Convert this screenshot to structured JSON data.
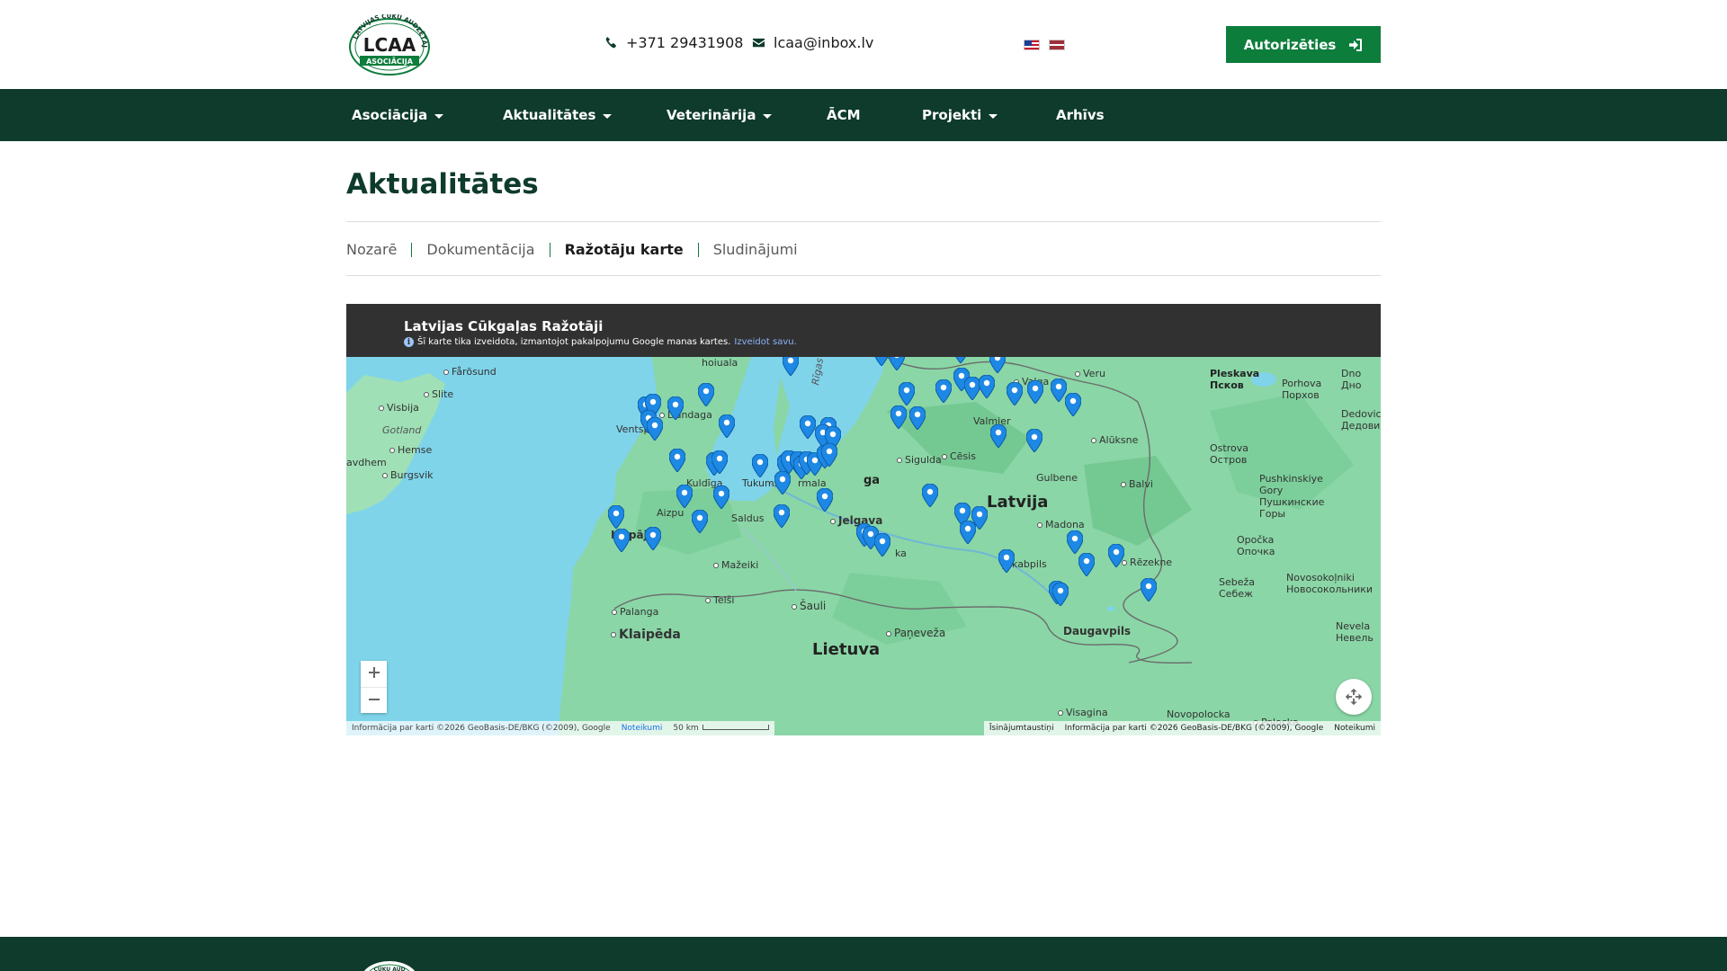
{
  "header": {
    "logo": {
      "arc_text": "LATVIJAS CŪKU AUDZĒTĀJU",
      "main_text": "LCAA",
      "ribbon_text": "ASOCIĀCIJA"
    },
    "phone": "+371 29431908",
    "email": "lcaa@inbox.lv",
    "languages": [
      "en",
      "lv"
    ],
    "login_label": "Autorizēties",
    "colors": {
      "primary_green": "#0d7d3c",
      "dark_green": "#0e3b2b"
    }
  },
  "nav": {
    "items": [
      {
        "label": "Asociācija",
        "has_dropdown": true
      },
      {
        "label": "Aktualitātes",
        "has_dropdown": true
      },
      {
        "label": "Veterinārija",
        "has_dropdown": true
      },
      {
        "label": "ĀCM",
        "has_dropdown": false
      },
      {
        "label": "Projekti",
        "has_dropdown": true
      },
      {
        "label": "Arhīvs",
        "has_dropdown": false
      }
    ]
  },
  "page": {
    "title": "Aktualitātes",
    "tabs": [
      {
        "label": "Nozarē",
        "active": false
      },
      {
        "label": "Dokumentācija",
        "active": false
      },
      {
        "label": "Ražotāju karte",
        "active": true
      },
      {
        "label": "Sludinājumi",
        "active": false
      }
    ]
  },
  "map": {
    "title": "Latvijas Cūkgaļas Ražotāji",
    "info_text": "Šī karte tika izveidota, izmantojot pakalpojumu Google manas kartes.",
    "info_link": "Izveidot savu.",
    "labels": {
      "country_latvia": "Latvija",
      "country_lithuania": "Lietuva",
      "gotland": "Gotland",
      "gulf": "Rīgas līcis",
      "hoiuala": "hoiuala",
      "farosund": "Fårösund",
      "slite": "Slite",
      "visbija": "Visbija",
      "hemse": "Hemse",
      "burgsvik": "Burgsvik",
      "ljavdhem": "avdhem",
      "ventspils": "Ventspils",
      "dundaga": "Dundaga",
      "kuldiga": "Kuldīga",
      "tukums": "Tukums",
      "jurmala": "rmala",
      "riga": "ga",
      "aizpute": "Aizpu",
      "saldus": "Saldus",
      "liepaja": "Liepāja",
      "jelgava": "Jelgava",
      "bauska": "ka",
      "mazeiki": "Mažeiki",
      "telsi": "Telši",
      "siauli": "Šauli",
      "palanga": "Palanga",
      "klaipeda": "Klaipēda",
      "paneveza": "Paņeveža",
      "visagina": "Visagina",
      "valga": "Valga",
      "veru": "Veru",
      "valmiera": "Valmier",
      "cesis": "Cēsis",
      "sigulda": "Sigulda",
      "gulbene": "Gulbene",
      "aluksne": "Alūksne",
      "balvi": "Balvi",
      "madona": "Madona",
      "jekabpils": "Jēkabpils",
      "rezekne": "Rēzekne",
      "daugavpils": "Daugavpils",
      "pleskava": "Pleskava",
      "pskov": "Псков",
      "porhova": "Porhova",
      "porhov": "Порхов",
      "dno": "Dno",
      "dno_ru": "Дно",
      "dedovicki": "Dedovic",
      "dedovicki_ru": "Дедови",
      "ostrova": "Ostrova",
      "ostrov": "Остров",
      "pushkinskiye": "Pushkinskiye",
      "gory": "Gory",
      "pushkin_ru1": "Пушкинские",
      "pushkin_ru2": "Горы",
      "opocka": "Opočka",
      "opochka": "Опочка",
      "sebeza": "Sebeža",
      "sebezh": "Себеж",
      "novosokolniki": "Novosokoļniki",
      "novosokolniki_ru": "Новосокольники",
      "nevela": "Nevela",
      "nevel": "Невель",
      "novopolocka": "Novopolocka",
      "polocka": "Polocka"
    },
    "attribution_left": "Informācija par karti ©2026 GeoBasis-DE/BKG (©2009), Google",
    "terms_left": "Noteikumi",
    "scale": "50 km",
    "shortcuts": "Īsinājumtaustiņi",
    "attribution_right": "Informācija par karti ©2026 GeoBasis-DE/BKG (©2009), Google",
    "terms_right": "Noteikumi",
    "pin_color": "#1e88e5",
    "water_color": "#7fd4ea",
    "land_color": "#8ad6a6"
  }
}
